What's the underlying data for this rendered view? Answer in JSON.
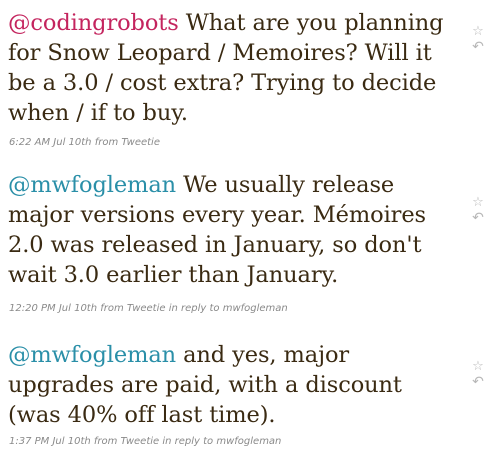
{
  "colors": {
    "tweet_text": "#3a2a12",
    "mention_primary": "#c4245e",
    "mention_secondary": "#2a8fa8",
    "meta_text": "#8a8a8a",
    "action_icon": "#b8b8b8"
  },
  "tweets": [
    {
      "mention": "@codingrobots",
      "mention_color": "#c4245e",
      "body": " What are you planning for Snow Leopard / Memoires? Will it be a 3.0 / cost extra? Trying to decide when / if to buy.",
      "meta": "6:22 AM Jul 10th from Tweetie",
      "star_icon": "star-icon",
      "reply_icon": "reply-icon",
      "star_glyph": "☆",
      "reply_glyph": "↶"
    },
    {
      "mention": "@mwfogleman",
      "mention_color": "#2a8fa8",
      "body": " We usually release major versions every year. Mémoires 2.0 was released in January, so don't wait 3.0 earlier than January.",
      "meta": "12:20 PM Jul 10th from Tweetie in reply to mwfogleman",
      "star_icon": "star-icon",
      "reply_icon": "reply-icon",
      "star_glyph": "☆",
      "reply_glyph": "↶"
    },
    {
      "mention": "@mwfogleman",
      "mention_color": "#2a8fa8",
      "body": " and yes, major upgrades are paid, with a discount (was 40% off last time).",
      "meta": "1:37 PM Jul 10th from Tweetie in reply to mwfogleman",
      "star_icon": "star-icon",
      "reply_icon": "reply-icon",
      "star_glyph": "☆",
      "reply_glyph": "↶"
    }
  ]
}
